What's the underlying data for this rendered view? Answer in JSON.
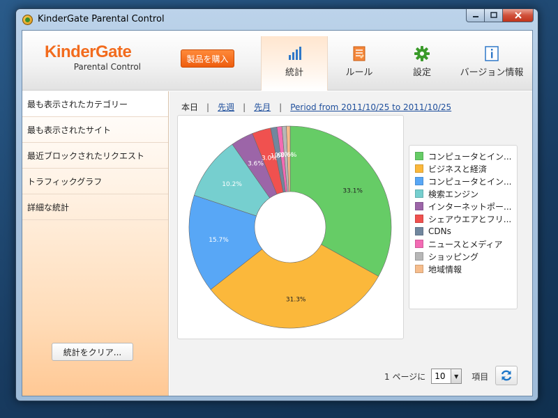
{
  "window": {
    "title": "KinderGate Parental Control"
  },
  "header": {
    "logo_main": "KinderGate",
    "logo_sub": "Parental Control",
    "buy_label": "製品を購入",
    "tabs": [
      {
        "label": "統計",
        "icon": "bar-chart-icon",
        "active": true
      },
      {
        "label": "ルール",
        "icon": "rules-document-icon",
        "active": false
      },
      {
        "label": "設定",
        "icon": "gear-icon",
        "active": false
      },
      {
        "label": "バージョン情報",
        "icon": "info-icon",
        "active": false
      }
    ]
  },
  "sidebar": {
    "items": [
      {
        "label": "最も表示されたカテゴリー"
      },
      {
        "label": "最も表示されたサイト"
      },
      {
        "label": "最近ブロックされたリクエスト"
      },
      {
        "label": "トラフィックグラフ"
      },
      {
        "label": "詳細な統計"
      }
    ],
    "clear_label": "統計をクリア..."
  },
  "period": {
    "today": "本日",
    "last_week": "先週",
    "last_month": "先月",
    "range": "Period from 2011/10/25 to 2011/10/25"
  },
  "chart_data": {
    "type": "pie",
    "donut": true,
    "categories": [
      "コンピュータとイン...",
      "ビジネスと経済",
      "コンピュータとイン...",
      "検索エンジン",
      "インターネットポー...",
      "シェアウエアとフリ...",
      "CDNs",
      "ニュースとメディア",
      "ショッピング",
      "地域情報"
    ],
    "values": [
      33.1,
      31.3,
      15.7,
      10.2,
      3.6,
      3.0,
      1.0,
      0.8,
      0.7,
      0.6
    ],
    "labels": [
      "33.1%",
      "31.3%",
      "15.7%",
      "10.2%",
      "3.6%",
      "3.0%",
      "1.0%",
      "0.8%",
      "0.7%",
      "0.6%"
    ],
    "colors": [
      "#66cc66",
      "#fbb83b",
      "#58a7f6",
      "#76cfcf",
      "#9c65a8",
      "#f0514f",
      "#71879e",
      "#f36bb4",
      "#b7b7b7",
      "#f6bd8c"
    ],
    "legend": "right"
  },
  "pager": {
    "per_page_label": "1 ページに",
    "per_page_value": "10",
    "items_label": "項目"
  },
  "icons": {
    "refresh": "refresh-icon",
    "app": "kindergate-app-icon",
    "dropdown": "chevron-down-icon"
  }
}
